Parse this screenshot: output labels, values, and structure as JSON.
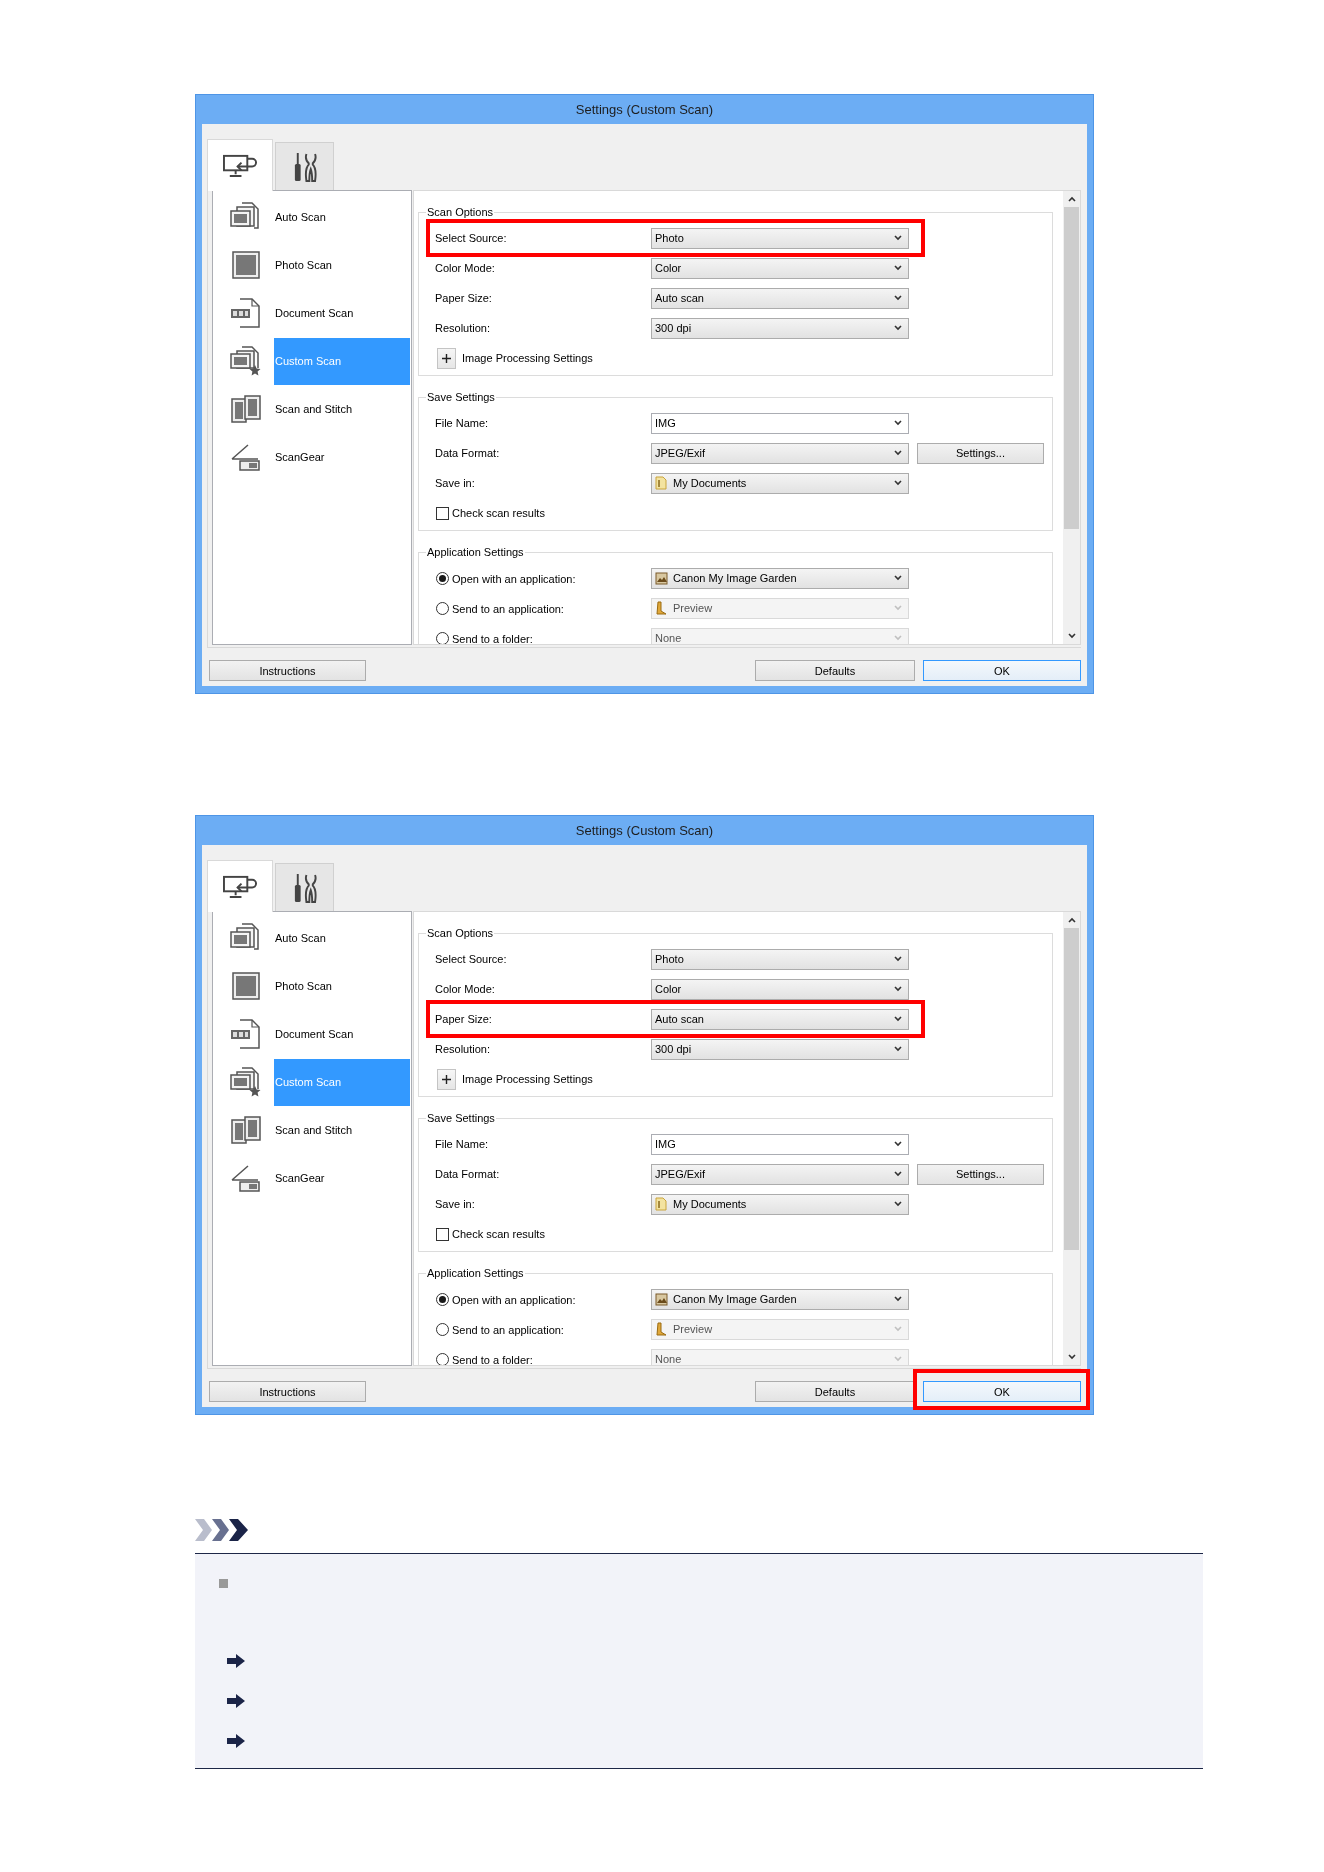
{
  "dialogs": [
    {
      "title": "Settings (Custom Scan)",
      "tabs": [
        {
          "selected": true
        },
        {
          "selected": false
        }
      ],
      "scan_modes": [
        {
          "label": "Auto Scan",
          "selected": false
        },
        {
          "label": "Photo Scan",
          "selected": false
        },
        {
          "label": "Document Scan",
          "selected": false
        },
        {
          "label": "Custom Scan",
          "selected": true
        },
        {
          "label": "Scan and Stitch",
          "selected": false
        },
        {
          "label": "ScanGear",
          "selected": false
        }
      ],
      "groups": [
        {
          "title": "Scan Options",
          "rows": [
            {
              "kind": "dropdown",
              "label": "Select Source:",
              "value": "Photo",
              "highlighted": true
            },
            {
              "kind": "dropdown",
              "label": "Color Mode:",
              "value": "Color",
              "highlighted": false
            },
            {
              "kind": "dropdown",
              "label": "Paper Size:",
              "value": "Auto scan",
              "highlighted": false
            },
            {
              "kind": "dropdown",
              "label": "Resolution:",
              "value": "300 dpi",
              "highlighted": false
            },
            {
              "kind": "expander",
              "label": "Image Processing Settings",
              "expanded": false
            }
          ]
        },
        {
          "title": "Save Settings",
          "rows": [
            {
              "kind": "combo",
              "label": "File Name:",
              "value": "IMG",
              "highlighted": false
            },
            {
              "kind": "dropdown",
              "label": "Data Format:",
              "value": "JPEG/Exif",
              "button": "Settings...",
              "highlighted": false
            },
            {
              "kind": "dropdown",
              "label": "Save in:",
              "value": "My Documents",
              "highlighted": false
            },
            {
              "kind": "checkbox",
              "label": "Check scan results",
              "checked": false
            }
          ]
        },
        {
          "title": "Application Settings",
          "rows": [
            {
              "kind": "radio",
              "label": "Open with an application:",
              "selected": true,
              "value": "Canon My Image Garden",
              "disabled": false
            },
            {
              "kind": "radio",
              "label": "Send to an application:",
              "selected": false,
              "value": "Preview",
              "disabled": true
            },
            {
              "kind": "radio",
              "label": "Send to a folder:",
              "selected": false,
              "value": "None",
              "disabled": true
            }
          ]
        }
      ],
      "buttons": [
        {
          "label": "Instructions",
          "default": false,
          "highlighted": false
        },
        {
          "label": "Defaults",
          "default": false,
          "highlighted": false
        },
        {
          "label": "OK",
          "default": true,
          "highlighted": false
        }
      ]
    },
    {
      "title": "Settings (Custom Scan)",
      "tabs": [
        {
          "selected": true
        },
        {
          "selected": false
        }
      ],
      "scan_modes": [
        {
          "label": "Auto Scan",
          "selected": false
        },
        {
          "label": "Photo Scan",
          "selected": false
        },
        {
          "label": "Document Scan",
          "selected": false
        },
        {
          "label": "Custom Scan",
          "selected": true
        },
        {
          "label": "Scan and Stitch",
          "selected": false
        },
        {
          "label": "ScanGear",
          "selected": false
        }
      ],
      "groups": [
        {
          "title": "Scan Options",
          "rows": [
            {
              "kind": "dropdown",
              "label": "Select Source:",
              "value": "Photo",
              "highlighted": false
            },
            {
              "kind": "dropdown",
              "label": "Color Mode:",
              "value": "Color",
              "highlighted": false
            },
            {
              "kind": "dropdown",
              "label": "Paper Size:",
              "value": "Auto scan",
              "highlighted": true
            },
            {
              "kind": "dropdown",
              "label": "Resolution:",
              "value": "300 dpi",
              "highlighted": false
            },
            {
              "kind": "expander",
              "label": "Image Processing Settings",
              "expanded": false
            }
          ]
        },
        {
          "title": "Save Settings",
          "rows": [
            {
              "kind": "combo",
              "label": "File Name:",
              "value": "IMG",
              "highlighted": false
            },
            {
              "kind": "dropdown",
              "label": "Data Format:",
              "value": "JPEG/Exif",
              "button": "Settings...",
              "highlighted": false
            },
            {
              "kind": "dropdown",
              "label": "Save in:",
              "value": "My Documents",
              "highlighted": false
            },
            {
              "kind": "checkbox",
              "label": "Check scan results",
              "checked": false
            }
          ]
        },
        {
          "title": "Application Settings",
          "rows": [
            {
              "kind": "radio",
              "label": "Open with an application:",
              "selected": true,
              "value": "Canon My Image Garden",
              "disabled": false
            },
            {
              "kind": "radio",
              "label": "Send to an application:",
              "selected": false,
              "value": "Preview",
              "disabled": true
            },
            {
              "kind": "radio",
              "label": "Send to a folder:",
              "selected": false,
              "value": "None",
              "disabled": true
            }
          ]
        }
      ],
      "buttons": [
        {
          "label": "Instructions",
          "default": false,
          "highlighted": false
        },
        {
          "label": "Defaults",
          "default": false,
          "highlighted": false
        },
        {
          "label": "OK",
          "default": true,
          "highlighted": true
        }
      ]
    }
  ]
}
